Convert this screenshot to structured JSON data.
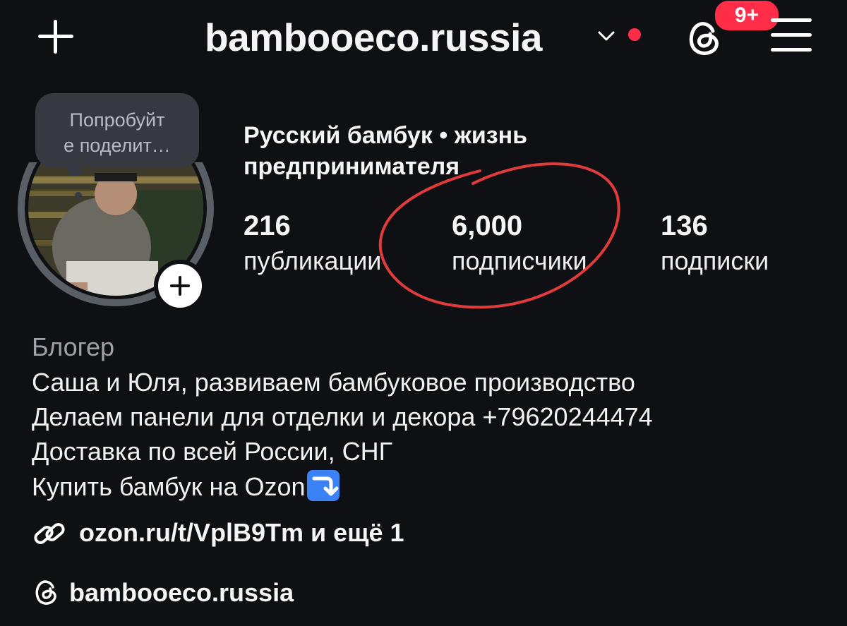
{
  "header": {
    "username": "bambooeco.russia",
    "notification_badge": "9+",
    "accent_color": "#ff2d48"
  },
  "profile": {
    "share_prompt_line1": "Попробуйт",
    "share_prompt_line2": "е поделит…",
    "full_name": "Русский бамбук • жизнь предпринимателя"
  },
  "stats": [
    {
      "value": "216",
      "label": "публикации"
    },
    {
      "value": "6,000",
      "label": "подписчики"
    },
    {
      "value": "136",
      "label": "подписки"
    }
  ],
  "bio": {
    "category": "Блогер",
    "lines": [
      "Саша и Юля, развиваем бамбуковое производство",
      "Делаем панели для отделки и декора +79620244474",
      "Доставка по всей России, СНГ",
      "Купить бамбук на Ozon"
    ],
    "link": "ozon.ru/t/VplB9Tm и ещё 1",
    "threads_handle": "bambooeco.russia"
  },
  "icons": {
    "add": "plus-icon",
    "threads": "threads-icon",
    "menu": "hamburger-menu-icon",
    "link": "link-chain-icon",
    "arrow": "arrow-down-right-emoji"
  }
}
